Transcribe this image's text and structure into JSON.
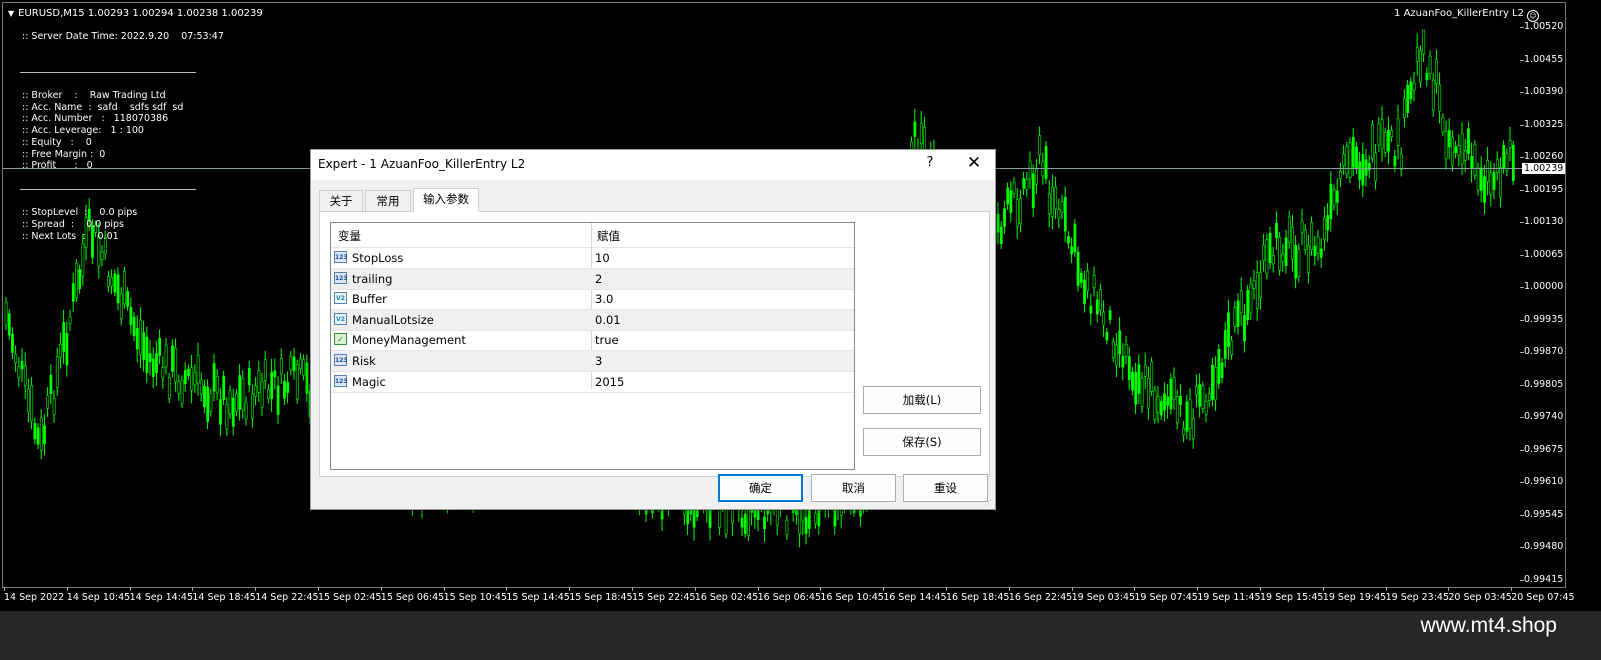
{
  "chart": {
    "symbol_title": "EURUSD,M15  1.00293 1.00294 1.00238 1.00239",
    "ea_title": "1 AzuanFoo_KillerEntry L2",
    "current_price": "1.00239",
    "price_ticks": [
      "1.00520",
      "1.00455",
      "1.00390",
      "1.00325",
      "1.00260",
      "1.00195",
      "1.00130",
      "1.00065",
      "1.00000",
      "0.99935",
      "0.99870",
      "0.99805",
      "0.99740",
      "0.99675",
      "0.99610",
      "0.99545",
      "0.99480",
      "0.99415"
    ],
    "time_ticks": [
      "14 Sep 2022",
      "14 Sep 10:45",
      "14 Sep 14:45",
      "14 Sep 18:45",
      "14 Sep 22:45",
      "15 Sep 02:45",
      "15 Sep 06:45",
      "15 Sep 10:45",
      "15 Sep 14:45",
      "15 Sep 18:45",
      "15 Sep 22:45",
      "16 Sep 02:45",
      "16 Sep 06:45",
      "16 Sep 10:45",
      "16 Sep 14:45",
      "16 Sep 18:45",
      "16 Sep 22:45",
      "19 Sep 03:45",
      "19 Sep 07:45",
      "19 Sep 11:45",
      "19 Sep 15:45",
      "19 Sep 19:45",
      "19 Sep 23:45",
      "20 Sep 03:45",
      "20 Sep 07:45"
    ],
    "candle_color": "#00ff00",
    "background": "#000000"
  },
  "info": {
    "server_time": ":: Server Date Time: 2022.9.20    07:53:47",
    "broker": ":: Broker    :    Raw Trading Ltd",
    "acc_name": ":: Acc. Name  :  safd    sdfs sdf  sd",
    "acc_number": ":: Acc. Number   :   118070386",
    "acc_leverage": ":: Acc. Leverage:   1 : 100",
    "equity": ":: Equity   :    0",
    "free_margin": ":: Free Margin :  0",
    "profit": ":: Profit      :   0",
    "stop_level": ":: StopLevel  :    0.0 pips",
    "spread": ":: Spread  :    0.0 pips",
    "next_lots": ":: Next Lots  :    0.01"
  },
  "dialog": {
    "title": "Expert - 1 AzuanFoo_KillerEntry L2",
    "help": "?",
    "close": "✕",
    "tabs": [
      "关于",
      "常用",
      "输入参数"
    ],
    "active_tab": "输入参数",
    "columns": [
      "变量",
      "赋值"
    ],
    "params": [
      {
        "icon": "123",
        "type": "int",
        "name": "StopLoss",
        "value": "10"
      },
      {
        "icon": "123",
        "type": "int",
        "name": "trailing",
        "value": "2"
      },
      {
        "icon": "V2",
        "type": "double",
        "name": "Buffer",
        "value": "3.0"
      },
      {
        "icon": "V2",
        "type": "double",
        "name": "ManualLotsize",
        "value": "0.01"
      },
      {
        "icon": "✓",
        "type": "bool",
        "name": "MoneyManagement",
        "value": "true"
      },
      {
        "icon": "123",
        "type": "int",
        "name": "Risk",
        "value": "3"
      },
      {
        "icon": "123",
        "type": "int",
        "name": "Magic",
        "value": "2015"
      }
    ],
    "load_button": "加载(L)",
    "save_button": "保存(S)",
    "ok_button": "确定",
    "cancel_button": "取消",
    "reset_button": "重设"
  },
  "footer": {
    "site": "www.mt4.shop"
  }
}
